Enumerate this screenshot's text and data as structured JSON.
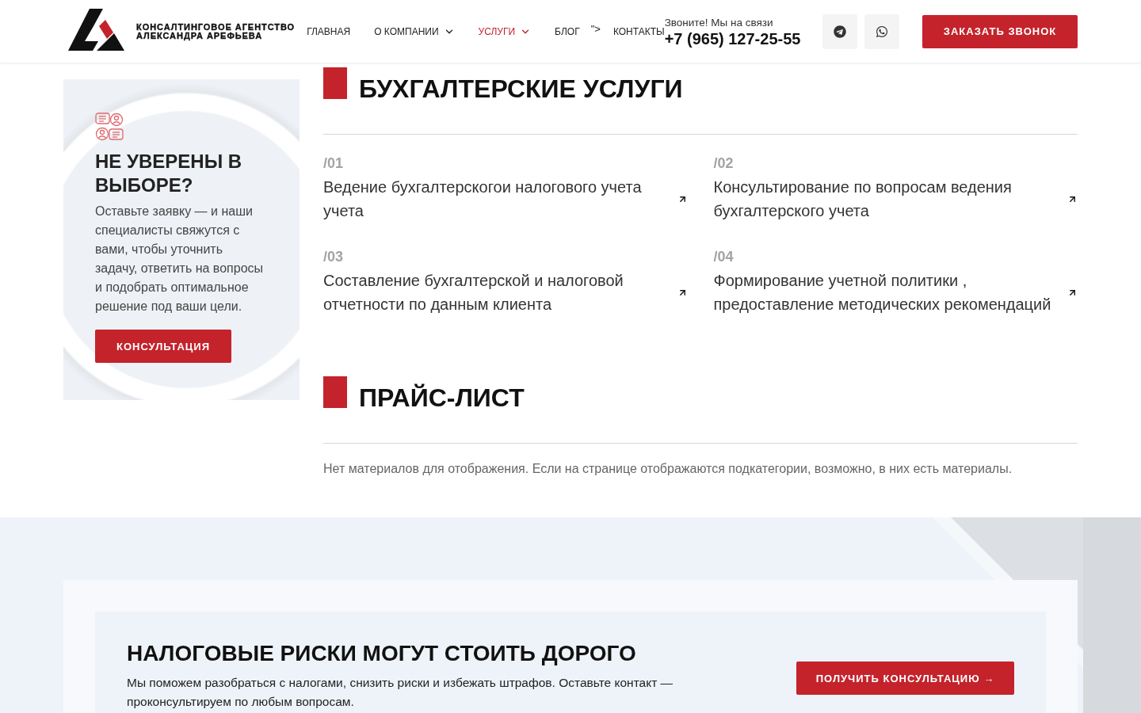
{
  "header": {
    "logo_text": [
      "КОНСАЛТИНГОВОЕ АГЕНТСТВО",
      "АЛЕКСАНДРА АРЕФЬЕВА"
    ],
    "nav": [
      {
        "label": "ГЛАВНАЯ",
        "kind": "link",
        "selected": false
      },
      {
        "label": "О КОМПАНИИ",
        "kind": "menu",
        "selected": false
      },
      {
        "label": "УСЛУГИ",
        "kind": "menu",
        "selected": true
      },
      {
        "label": "БЛОГ",
        "kind": "link",
        "selected": false
      },
      {
        "label": "\">",
        "kind": "text",
        "selected": false
      },
      {
        "label": "КОНТАКТЫ",
        "kind": "link",
        "selected": false
      }
    ],
    "phone": {
      "caption": "Звоните! Мы на связи",
      "number": "+7 (965) 127-25-55"
    },
    "social": [
      {
        "kind": "telegram"
      },
      {
        "kind": "whatsapp"
      }
    ],
    "call_button": "ЗАКАЗАТЬ ЗВОНОК"
  },
  "sidebar": {
    "title": "НЕ УВЕРЕНЫ В ВЫБОРЕ?",
    "text": "Оставьте заявку — и наши специалисты свяжутся с вами, чтобы уточнить задачу, ответить на вопросы и подобрать оптимальное решение под ваши цели.",
    "button": "КОНСУЛЬТАЦИЯ"
  },
  "sections": [
    {
      "kind": "services",
      "title": "БУХГАЛТЕРСКИЕ УСЛУГИ",
      "items": [
        {
          "number": "/01",
          "title": "Ведение бухгалтерскогои налогового учета учета"
        },
        {
          "number": "/02",
          "title": "Консультирование по вопросам ведения бухгалтерского учета"
        },
        {
          "number": "/03",
          "title": "Составление бухгалтерской и налоговой отчетности по данным клиента"
        },
        {
          "number": "/04",
          "title": "Формирование учетной политики , предоставление методических рекомендаций"
        }
      ]
    },
    {
      "kind": "empty",
      "title": "ПРАЙС-ЛИСТ",
      "message": "Нет материалов для отображения. Если на странице отображаются подкатегории, возможно, в них есть материалы."
    }
  ],
  "promo": {
    "title": "НАЛОГОВЫЕ РИСКИ МОГУТ СТОИТЬ ДОРОГО",
    "text": "Мы поможем разобраться с налогами, снизить риски и избежать штрафов. Оставьте контакт — проконсультируем по любым вопросам.",
    "button": "ПОЛУЧИТЬ КОНСУЛЬТАЦИЮ →"
  }
}
